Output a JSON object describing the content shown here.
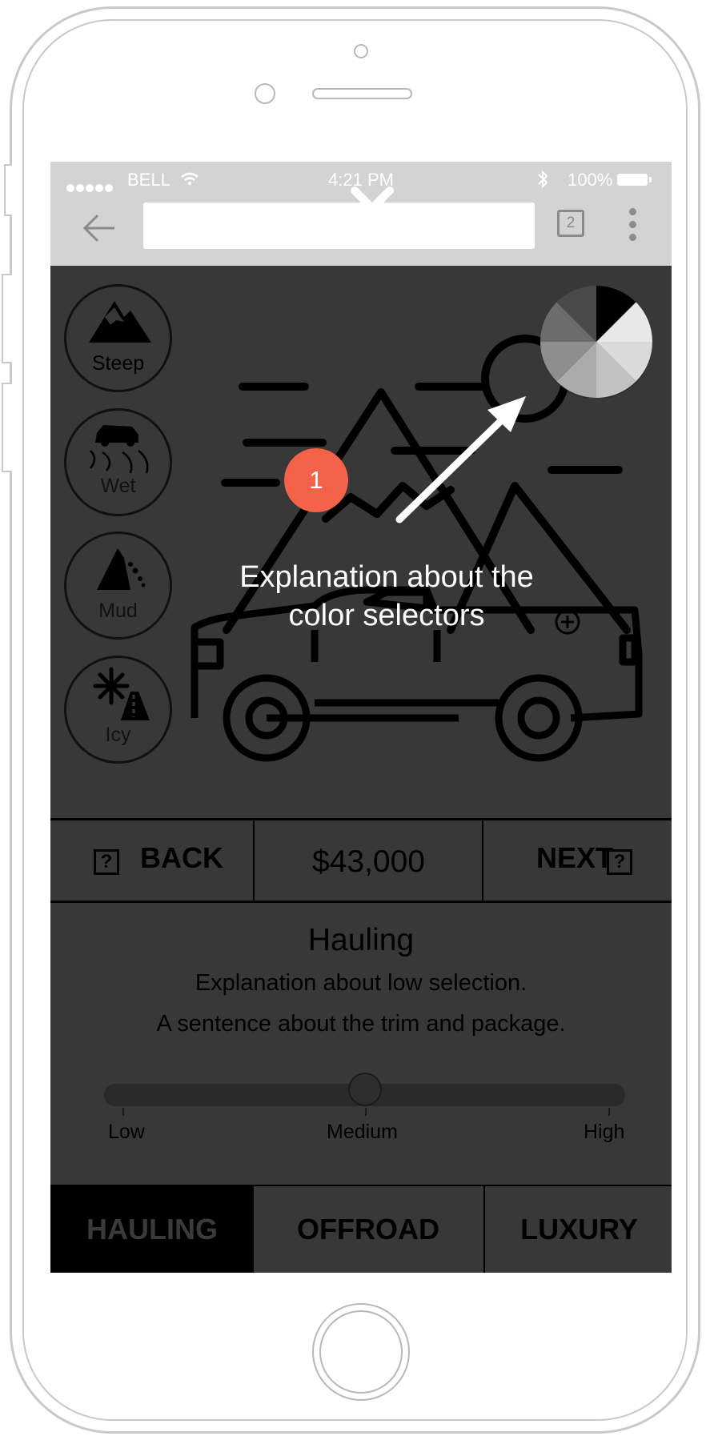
{
  "status_bar": {
    "carrier": "BELL",
    "time": "4:21 PM",
    "battery": "100%"
  },
  "browser": {
    "url_value": "",
    "tab_count": "2"
  },
  "conditions": [
    {
      "label": "Steep",
      "icon": "mountain-icon"
    },
    {
      "label": "Wet",
      "icon": "skidding-car-icon"
    },
    {
      "label": "Mud",
      "icon": "landslide-icon"
    },
    {
      "label": "Icy",
      "icon": "snow-road-icon"
    }
  ],
  "tooltip": {
    "step_number": "1",
    "text_line1": "Explanation about the",
    "text_line2": "color selectors"
  },
  "price_nav": {
    "back_label": "BACK",
    "back_help": "?",
    "price": "$43,000",
    "next_label": "NEXT",
    "next_help": "?"
  },
  "selection": {
    "title": "Hauling",
    "line1": "Explanation about low selection.",
    "line2": "A sentence about the trim and package."
  },
  "slider": {
    "low": "Low",
    "medium": "Medium",
    "high": "High",
    "value": 0.5
  },
  "tabs": [
    {
      "label": "HAULING",
      "active": true
    },
    {
      "label": "OFFROAD",
      "active": false
    },
    {
      "label": "LUXURY",
      "active": false
    }
  ],
  "colors": {
    "annotation": "#f4624a",
    "screen_bg": "#383838",
    "chrome": "#d3d3d3"
  }
}
